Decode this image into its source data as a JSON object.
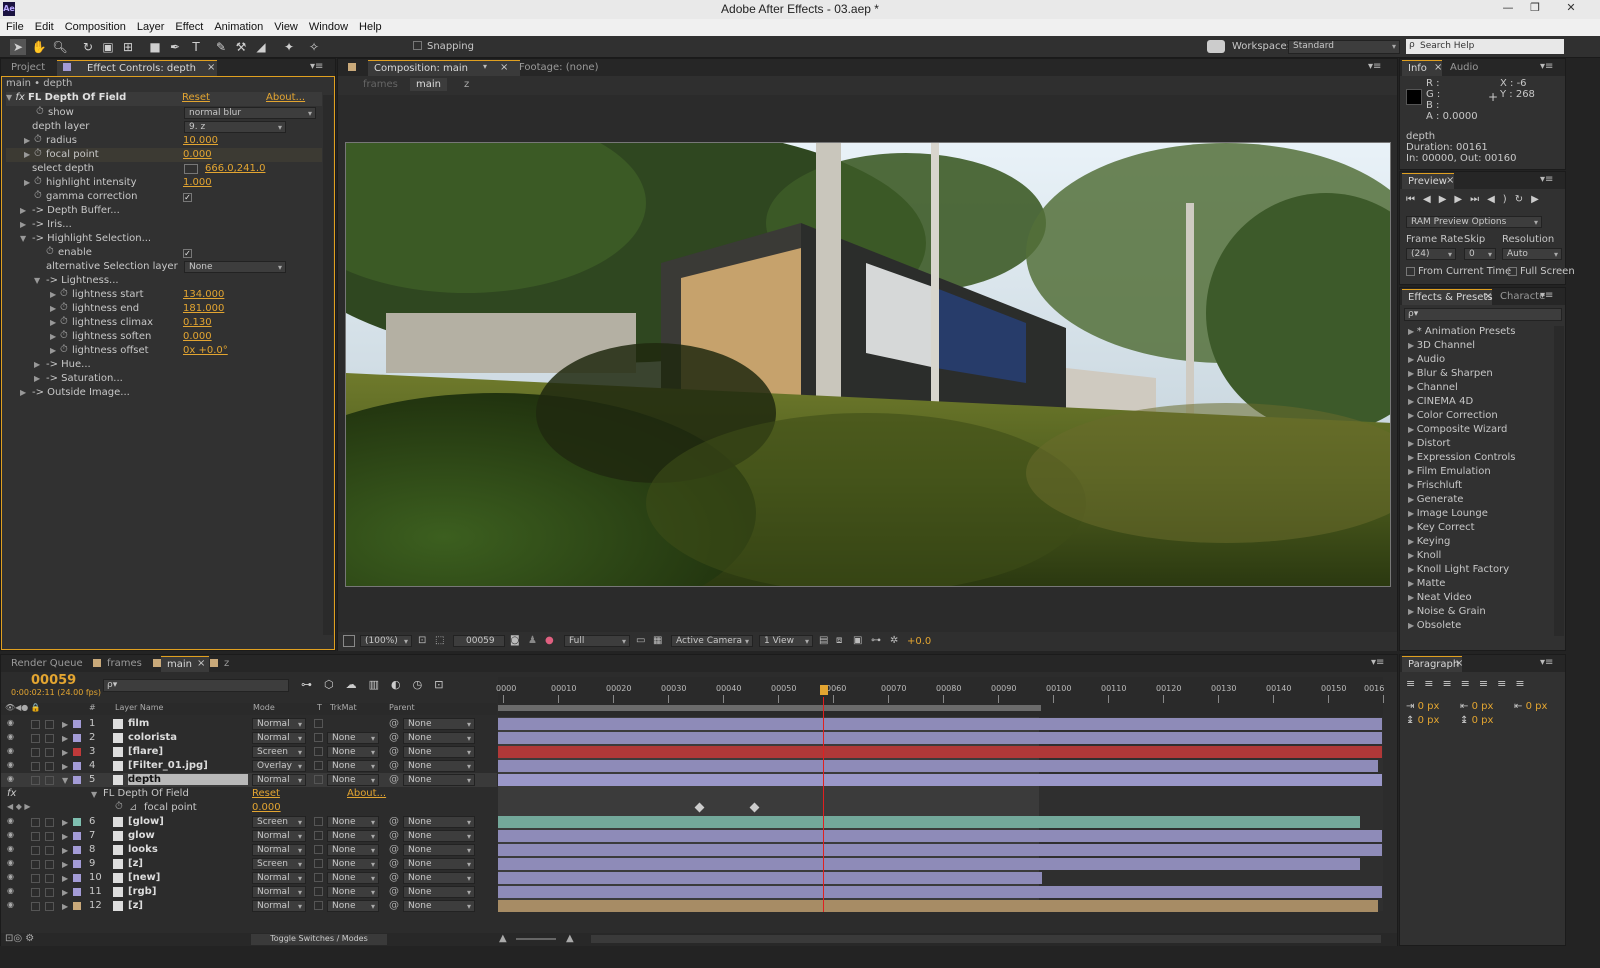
{
  "window": {
    "title": "Adobe After Effects - 03.aep *",
    "app_icon": "Ae"
  },
  "menu": [
    "File",
    "Edit",
    "Composition",
    "Layer",
    "Effect",
    "Animation",
    "View",
    "Window",
    "Help"
  ],
  "toolbar": {
    "snapping": "Snapping",
    "workspace_label": "Workspace:",
    "workspace_value": "Standard",
    "search_placeholder": "Search Help"
  },
  "left_panel": {
    "tab_project": "Project",
    "tab_effect_controls": "Effect Controls: depth",
    "breadcrumb": "main • depth",
    "effect_name": "FL Depth Of Field",
    "reset": "Reset",
    "about": "About...",
    "props": [
      {
        "label": "show",
        "type": "dropdown",
        "value": "normal blur"
      },
      {
        "label": "depth layer",
        "type": "dropdown",
        "value": "9. z"
      },
      {
        "label": "radius",
        "type": "value",
        "value": "10.000"
      },
      {
        "label": "focal point",
        "type": "value",
        "value": "0.000"
      },
      {
        "label": "select depth",
        "type": "point",
        "value": "666.0,241.0"
      },
      {
        "label": "highlight intensity",
        "type": "value",
        "value": "1.000"
      },
      {
        "label": "gamma correction",
        "type": "check",
        "value": "✓"
      },
      {
        "label": "-> Depth Buffer...",
        "type": "group"
      },
      {
        "label": "-> Iris...",
        "type": "group"
      },
      {
        "label": "-> Highlight Selection...",
        "type": "group"
      },
      {
        "label": "enable",
        "type": "check",
        "value": "✓"
      },
      {
        "label": "alternative Selection layer",
        "type": "dropdown",
        "value": "None"
      },
      {
        "label": "-> Lightness...",
        "type": "group"
      },
      {
        "label": "lightness start",
        "type": "value",
        "value": "134.000"
      },
      {
        "label": "lightness end",
        "type": "value",
        "value": "181.000"
      },
      {
        "label": "lightness climax",
        "type": "value",
        "value": "0.130"
      },
      {
        "label": "lightness soften",
        "type": "value",
        "value": "0.000"
      },
      {
        "label": "lightness offset",
        "type": "value",
        "value": "0x +0.0°"
      },
      {
        "label": "-> Hue...",
        "type": "group"
      },
      {
        "label": "-> Saturation...",
        "type": "group"
      },
      {
        "label": "-> Outside Image...",
        "type": "group"
      }
    ]
  },
  "comp_panel": {
    "tab_composition": "Composition: main",
    "tab_footage": "Footage: (none)",
    "crumb_frames": "frames",
    "crumb_main": "main",
    "crumb_z": "z",
    "zoom": "(100%)",
    "timecode": "00059",
    "resolution": "Full",
    "camera": "Active Camera",
    "views": "1 View",
    "exposure": "+0.0"
  },
  "info_panel": {
    "tab_info": "Info",
    "tab_audio": "Audio",
    "r": "R :",
    "g": "G :",
    "b": "B :",
    "a": "A :  0.0000",
    "x": "X : -6",
    "y": "Y : 268",
    "layer": "depth",
    "duration": "Duration: 00161",
    "inout": "In: 00000, Out: 00160"
  },
  "preview_panel": {
    "tab": "Preview",
    "ram_options": "RAM Preview Options",
    "frame_rate_label": "Frame Rate",
    "skip_label": "Skip",
    "resolution_label": "Resolution",
    "frame_rate": "(24)",
    "skip": "0",
    "resolution": "Auto",
    "from_current": "From Current Time",
    "full_screen": "Full Screen"
  },
  "effects_panel": {
    "tab": "Effects & Presets",
    "tab2": "Characte",
    "search_placeholder": "ρ▾",
    "items": [
      "* Animation Presets",
      "3D Channel",
      "Audio",
      "Blur & Sharpen",
      "Channel",
      "CINEMA 4D",
      "Color Correction",
      "Composite Wizard",
      "Distort",
      "Expression Controls",
      "Film Emulation",
      "Frischluft",
      "Generate",
      "Image Lounge",
      "Key Correct",
      "Keying",
      "Knoll",
      "Knoll Light Factory",
      "Matte",
      "Neat Video",
      "Noise & Grain",
      "Obsolete"
    ]
  },
  "paragraph_panel": {
    "tab": "Paragraph",
    "indent1": "0 px",
    "indent2": "0 px",
    "indent3": "0 px",
    "space1": "0 px",
    "space2": "0 px"
  },
  "timeline": {
    "tab_render": "Render Queue",
    "tab_frames": "frames",
    "tab_main": "main",
    "tab_z": "z",
    "current_frame": "00059",
    "current_time": "0:00:02:11 (24.00 fps)",
    "search_placeholder": "ρ▾",
    "col_num": "#",
    "col_name": "Layer Name",
    "col_mode": "Mode",
    "col_t": "T",
    "col_trkmat": "TrkMat",
    "col_parent": "Parent",
    "ticks": [
      "0000",
      "00010",
      "00020",
      "00030",
      "00040",
      "00050",
      "0060",
      "00070",
      "00080",
      "00090",
      "00100",
      "00110",
      "00120",
      "00130",
      "00140",
      "00150",
      "0016"
    ],
    "sub_effect": "FL Depth Of Field",
    "sub_reset": "Reset",
    "sub_about": "About...",
    "sub_prop": "focal point",
    "sub_val": "0.000",
    "toggle_label": "Toggle Switches / Modes",
    "layers": [
      {
        "num": "1",
        "name": "film",
        "mode": "Normal",
        "trkmat": "",
        "parent": "None",
        "color": "#a39bd6",
        "bar": "#8e8bb8",
        "end": 1.0
      },
      {
        "num": "2",
        "name": "colorista",
        "mode": "Normal",
        "trkmat": "None",
        "parent": "None",
        "color": "#a39bd6",
        "bar": "#8e8bb8",
        "end": 1.0
      },
      {
        "num": "3",
        "name": "[flare]",
        "mode": "Screen",
        "trkmat": "None",
        "parent": "None",
        "color": "#c03a3a",
        "bar": "#b03838",
        "end": 1.0
      },
      {
        "num": "4",
        "name": "[Filter_01.jpg]",
        "mode": "Overlay",
        "trkmat": "None",
        "parent": "None",
        "color": "#a39bd6",
        "bar": "#8e8bb8",
        "end": 0.995
      },
      {
        "num": "5",
        "name": "depth",
        "mode": "Normal",
        "trkmat": "None",
        "parent": "None",
        "color": "#a39bd6",
        "bar": "#9a97c8",
        "end": 1.0
      },
      {
        "num": "6",
        "name": "[glow]",
        "mode": "Screen",
        "trkmat": "None",
        "parent": "None",
        "color": "#7fbfb0",
        "bar": "#73a89a",
        "end": 0.975
      },
      {
        "num": "7",
        "name": "glow",
        "mode": "Normal",
        "trkmat": "None",
        "parent": "None",
        "color": "#a39bd6",
        "bar": "#8e8bb8",
        "end": 1.0
      },
      {
        "num": "8",
        "name": "looks",
        "mode": "Normal",
        "trkmat": "None",
        "parent": "None",
        "color": "#a39bd6",
        "bar": "#8e8bb8",
        "end": 1.0
      },
      {
        "num": "9",
        "name": "[z]",
        "mode": "Screen",
        "trkmat": "None",
        "parent": "None",
        "color": "#a39bd6",
        "bar": "#8e8bb8",
        "end": 0.975
      },
      {
        "num": "10",
        "name": "[new]",
        "mode": "Normal",
        "trkmat": "None",
        "parent": "None",
        "color": "#a39bd6",
        "bar": "#8e8bb8",
        "end": 0.615
      },
      {
        "num": "11",
        "name": "[rgb]",
        "mode": "Normal",
        "trkmat": "None",
        "parent": "None",
        "color": "#a39bd6",
        "bar": "#8e8bb8",
        "end": 1.0
      },
      {
        "num": "12",
        "name": "[z]",
        "mode": "Normal",
        "trkmat": "None",
        "parent": "None",
        "color": "#c9a97a",
        "bar": "#a78c65",
        "end": 0.995
      }
    ]
  }
}
